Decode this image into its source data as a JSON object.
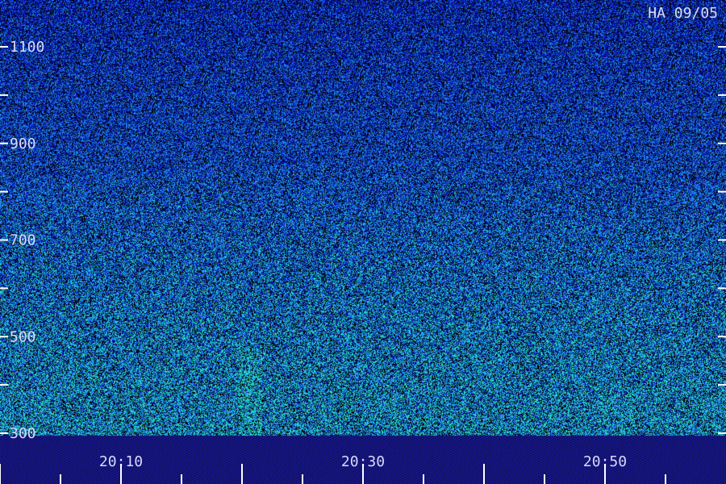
{
  "chart_data": {
    "type": "heatmap",
    "title": "HA 09/05",
    "y_tick_labels": [
      "1100",
      "900",
      "700",
      "500",
      "300"
    ],
    "y_ticks": [
      1100,
      1000,
      900,
      800,
      700,
      600,
      500,
      400,
      300
    ],
    "ylim": [
      300,
      1125
    ],
    "x_tick_labels": [
      "20:10",
      "20:30",
      "20:50"
    ],
    "xlim": [
      "20:00",
      "21:00"
    ],
    "colors": {
      "background": "#000000",
      "low": "#0a1a9a",
      "mid": "#1f6fe8",
      "high": "#29e0c0",
      "axis_band": "#1a1a80",
      "ticks": "#ffffff",
      "labels": "#d8d8ff"
    }
  }
}
